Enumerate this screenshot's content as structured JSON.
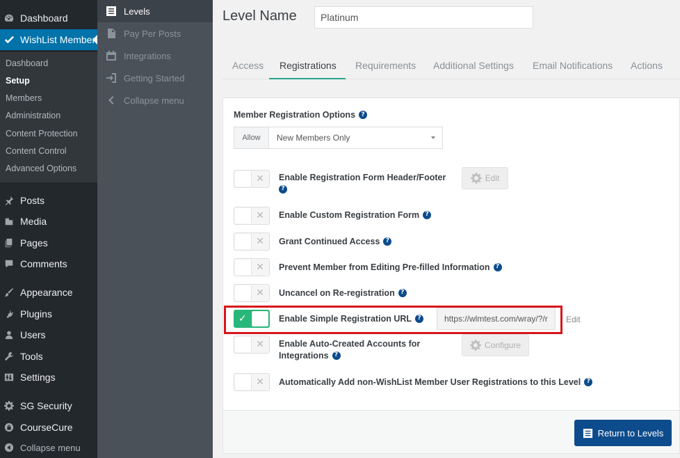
{
  "wp_menu": {
    "dashboard": "Dashboard",
    "wishlist": "WishList Member",
    "submenu": [
      "Dashboard",
      "Setup",
      "Members",
      "Administration",
      "Content Protection",
      "Content Control",
      "Advanced Options"
    ],
    "posts": "Posts",
    "media": "Media",
    "pages": "Pages",
    "comments": "Comments",
    "appearance": "Appearance",
    "plugins": "Plugins",
    "users": "Users",
    "tools": "Tools",
    "settings": "Settings",
    "sg_security": "SG Security",
    "coursecure": "CourseCure",
    "collapse": "Collapse menu"
  },
  "wlm_menu": {
    "levels": "Levels",
    "pay_per_posts": "Pay Per Posts",
    "integrations": "Integrations",
    "getting_started": "Getting Started",
    "collapse": "Collapse menu"
  },
  "header": {
    "level_name_label": "Level Name",
    "level_name_value": "Platinum"
  },
  "tabs": [
    "Access",
    "Registrations",
    "Requirements",
    "Additional Settings",
    "Email Notifications",
    "Actions"
  ],
  "form": {
    "member_registration_options": "Member Registration Options",
    "allow_label": "Allow",
    "allow_value": "New Members Only",
    "options": {
      "header_footer": "Enable Registration Form Header/Footer",
      "custom_form": "Enable Custom Registration Form",
      "grant_continued": "Grant Continued Access",
      "prevent_editing": "Prevent Member from Editing Pre-filled Information",
      "uncancel": "Uncancel on Re-registration",
      "simple_url": "Enable Simple Registration URL",
      "auto_created_line1": "Enable Auto-Created Accounts for",
      "auto_created_line2": "Integrations",
      "auto_add": "Automatically Add non-WishList Member User Registrations to this Level"
    },
    "edit_button": "Edit",
    "configure_button": "Configure",
    "simple_url_value": "https://wlmtest.com/wray/?/r",
    "url_edit": "Edit",
    "toggle_off_mark": "✕",
    "toggle_on_mark": "✓",
    "help_mark": "?"
  },
  "footer": {
    "return_button": "Return to Levels"
  },
  "colors": {
    "accent": "#0073aa",
    "toggle_on": "#28b779",
    "primary_button": "#0d4c8c",
    "highlight": "#d9141b"
  }
}
